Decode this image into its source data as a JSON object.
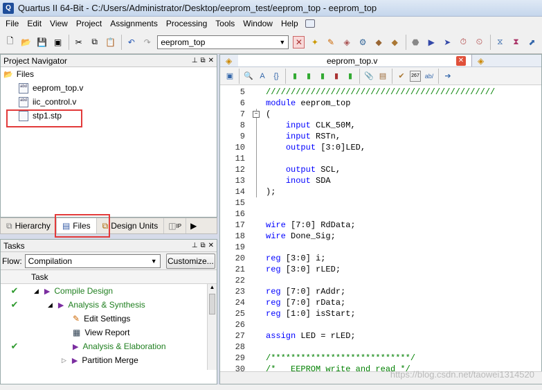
{
  "window": {
    "title": "Quartus II 64-Bit - C:/Users/Administrator/Desktop/eeprom_test/eeprom_top - eeprom_top"
  },
  "menu": [
    "File",
    "Edit",
    "View",
    "Project",
    "Assignments",
    "Processing",
    "Tools",
    "Window",
    "Help"
  ],
  "toolbar": {
    "entity_value": "eeprom_top"
  },
  "project_navigator": {
    "title": "Project Navigator",
    "root_label": "Files",
    "files": [
      {
        "icon": "abd",
        "name": "eeprom_top.v"
      },
      {
        "icon": "abd",
        "name": "iic_control.v"
      },
      {
        "icon": "",
        "name": "stp1.stp"
      }
    ],
    "tabs": [
      "Hierarchy",
      "Files",
      "Design Units",
      "IP"
    ]
  },
  "tasks": {
    "title": "Tasks",
    "flow_label": "Flow:",
    "flow_value": "Compilation",
    "customize_label": "Customize...",
    "column_header": "Task",
    "rows": [
      {
        "check": true,
        "indent": 1,
        "expander": "◢",
        "label": "Compile Design",
        "green": true
      },
      {
        "check": true,
        "indent": 2,
        "expander": "◢",
        "label": "Analysis & Synthesis",
        "green": true
      },
      {
        "check": false,
        "indent": 3,
        "expander": "",
        "label": "Edit Settings",
        "green": false
      },
      {
        "check": false,
        "indent": 3,
        "expander": "",
        "label": "View Report",
        "green": false
      },
      {
        "check": true,
        "indent": 3,
        "expander": "",
        "label": "Analysis & Elaboration",
        "green": true
      },
      {
        "check": false,
        "indent": 2,
        "expander": "▷",
        "label": "Partition Merge",
        "green": false
      }
    ]
  },
  "editor": {
    "tab_label": "eeprom_top.v",
    "watermark": "https://blog.csdn.net/taowei1314520",
    "lines": [
      {
        "n": "5",
        "parts": [
          {
            "t": "//////////////////////////////////////////////",
            "c": "cm"
          }
        ]
      },
      {
        "n": "6",
        "parts": [
          {
            "t": "module",
            "c": "kw"
          },
          {
            "t": " eeprom_top",
            "c": ""
          }
        ]
      },
      {
        "n": "7",
        "parts": [
          {
            "t": "(",
            "c": ""
          }
        ]
      },
      {
        "n": "8",
        "parts": [
          {
            "t": "    ",
            "c": ""
          },
          {
            "t": "input",
            "c": "kw"
          },
          {
            "t": " CLK_50M,",
            "c": ""
          }
        ]
      },
      {
        "n": "9",
        "parts": [
          {
            "t": "    ",
            "c": ""
          },
          {
            "t": "input",
            "c": "kw"
          },
          {
            "t": " RSTn,",
            "c": ""
          }
        ]
      },
      {
        "n": "10",
        "parts": [
          {
            "t": "    ",
            "c": ""
          },
          {
            "t": "output",
            "c": "kw"
          },
          {
            "t": " [3:0]LED,",
            "c": ""
          }
        ]
      },
      {
        "n": "11",
        "parts": []
      },
      {
        "n": "12",
        "parts": [
          {
            "t": "    ",
            "c": ""
          },
          {
            "t": "output",
            "c": "kw"
          },
          {
            "t": " SCL,",
            "c": ""
          }
        ]
      },
      {
        "n": "13",
        "parts": [
          {
            "t": "    ",
            "c": ""
          },
          {
            "t": "inout",
            "c": "kw"
          },
          {
            "t": " SDA",
            "c": ""
          }
        ]
      },
      {
        "n": "14",
        "parts": [
          {
            "t": ");",
            "c": ""
          }
        ]
      },
      {
        "n": "15",
        "parts": []
      },
      {
        "n": "16",
        "parts": []
      },
      {
        "n": "17",
        "parts": [
          {
            "t": "wire",
            "c": "kw"
          },
          {
            "t": " [7:0] RdData;",
            "c": ""
          }
        ]
      },
      {
        "n": "18",
        "parts": [
          {
            "t": "wire",
            "c": "kw"
          },
          {
            "t": " Done_Sig;",
            "c": ""
          }
        ]
      },
      {
        "n": "19",
        "parts": []
      },
      {
        "n": "20",
        "parts": [
          {
            "t": "reg",
            "c": "kw"
          },
          {
            "t": " [3:0] i;",
            "c": ""
          }
        ]
      },
      {
        "n": "21",
        "parts": [
          {
            "t": "reg",
            "c": "kw"
          },
          {
            "t": " [3:0] rLED;",
            "c": ""
          }
        ]
      },
      {
        "n": "22",
        "parts": []
      },
      {
        "n": "23",
        "parts": [
          {
            "t": "reg",
            "c": "kw"
          },
          {
            "t": " [7:0] rAddr;",
            "c": ""
          }
        ]
      },
      {
        "n": "24",
        "parts": [
          {
            "t": "reg",
            "c": "kw"
          },
          {
            "t": " [7:0] rData;",
            "c": ""
          }
        ]
      },
      {
        "n": "25",
        "parts": [
          {
            "t": "reg",
            "c": "kw"
          },
          {
            "t": " [1:0] isStart;",
            "c": ""
          }
        ]
      },
      {
        "n": "26",
        "parts": []
      },
      {
        "n": "27",
        "parts": [
          {
            "t": "assign",
            "c": "kw"
          },
          {
            "t": " LED = rLED;",
            "c": ""
          }
        ]
      },
      {
        "n": "28",
        "parts": []
      },
      {
        "n": "29",
        "parts": [
          {
            "t": "/****************************/",
            "c": "cm"
          }
        ]
      },
      {
        "n": "30",
        "parts": [
          {
            "t": "/*   EEPROM write and read */",
            "c": "cm"
          }
        ]
      }
    ]
  },
  "colors": {
    "highlight": "#e23a3a",
    "keyword": "#0000ff",
    "comment": "#008000"
  }
}
